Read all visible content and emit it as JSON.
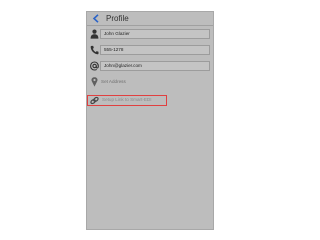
{
  "header": {
    "title": "Profile",
    "back_icon": "chevron-left-icon",
    "accent_color": "#2a63c8"
  },
  "profile": {
    "name": {
      "icon": "person-icon",
      "value": "John Glazier"
    },
    "phone": {
      "icon": "phone-icon",
      "value": "555-1278"
    },
    "email": {
      "icon": "at-sign-icon",
      "value": "John@glazier.com"
    },
    "address": {
      "icon": "map-pin-icon",
      "label": "Set Address"
    },
    "link": {
      "icon": "link-icon",
      "label": "Setup Link to Smart-EDI"
    }
  },
  "colors": {
    "background": "#bdbdbd",
    "highlight_border": "#e04040"
  }
}
